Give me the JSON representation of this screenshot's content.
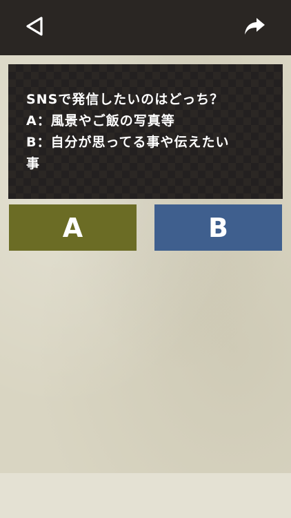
{
  "topbar": {
    "back_icon": "back-triangle-icon",
    "share_icon": "share-arrow-icon"
  },
  "question": {
    "text": "SNSで発信したいのはどっち？\nA：風景やご飯の写真等\nB：自分が思ってる事や伝えたい\n事"
  },
  "answers": {
    "a_label": "A",
    "b_label": "B"
  },
  "colors": {
    "topbar": "#2a2623",
    "question_bg": "#2b2724",
    "answer_a": "#6b6c25",
    "answer_b": "#3f5f8e",
    "paper": "#d9d5c2"
  }
}
